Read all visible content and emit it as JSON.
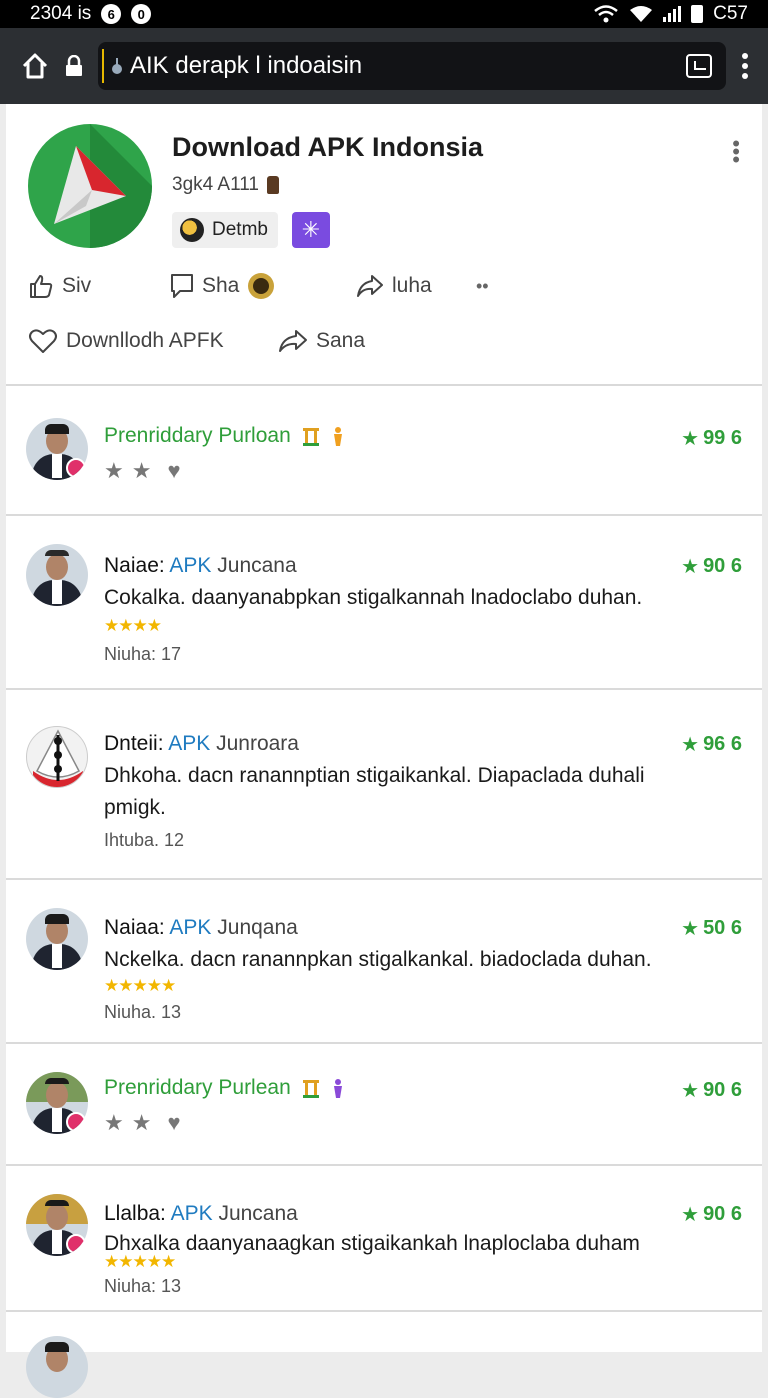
{
  "status_bar": {
    "time": "2304",
    "time_suffix": "is",
    "icon_a": "6",
    "icon_b": "0",
    "battery": "C57"
  },
  "browser": {
    "url": "AIK derapk l indoaisin"
  },
  "app": {
    "title": "Download APK Indonsia",
    "subtitle": "3gk4 A111",
    "chip_label": "Detmb",
    "actions": {
      "like_label": "Siv",
      "comment_label": "Sha",
      "share_label": "luha",
      "download_label": "Downllodh APFK",
      "save_label": "Sana"
    }
  },
  "reviews": [
    {
      "type": "short",
      "name": "Prenriddary Purloan",
      "rating": "99 6"
    },
    {
      "type": "full",
      "name_prefix": "Naiae:",
      "name_apk": "APK",
      "name_suffix": "Juncana",
      "rating": "90 6",
      "text": "Cokalka. daanyanabpkan stigalkannah lnadoclabo duhan.",
      "stars": "★★★★",
      "meta": "Niuha: 17"
    },
    {
      "type": "full",
      "name_prefix": "Dnteii:",
      "name_apk": "APK",
      "name_suffix": "Junroara",
      "rating": "96 6",
      "text": "Dhkoha. dacn ranannptian stigaikankal. Diapaclada duhali pmigk.",
      "stars": "",
      "meta": "Ihtuba. 12"
    },
    {
      "type": "full",
      "name_prefix": "Naiaa:",
      "name_apk": "APK",
      "name_suffix": "Junqana",
      "rating": "50 6",
      "text": "Nckelka. dacn ranannpkan stigalkankal. biadoclada duhan.",
      "stars": "★★★★★",
      "meta": "Niuha. 13"
    },
    {
      "type": "short",
      "name": "Prenriddary Purlean",
      "rating": "90 6"
    },
    {
      "type": "full",
      "name_prefix": "Llalba:",
      "name_apk": "APK",
      "name_suffix": "Juncana",
      "rating": "90 6",
      "text": "Dhxalka daanyanaagkan stigaikankah lnaploclaba duham",
      "stars": "★★★★★",
      "meta": "Niuha: 13"
    }
  ],
  "colors": {
    "accent_green": "#2f9e3a",
    "link_blue": "#1f7bc0",
    "star_gold": "#f2b600"
  }
}
